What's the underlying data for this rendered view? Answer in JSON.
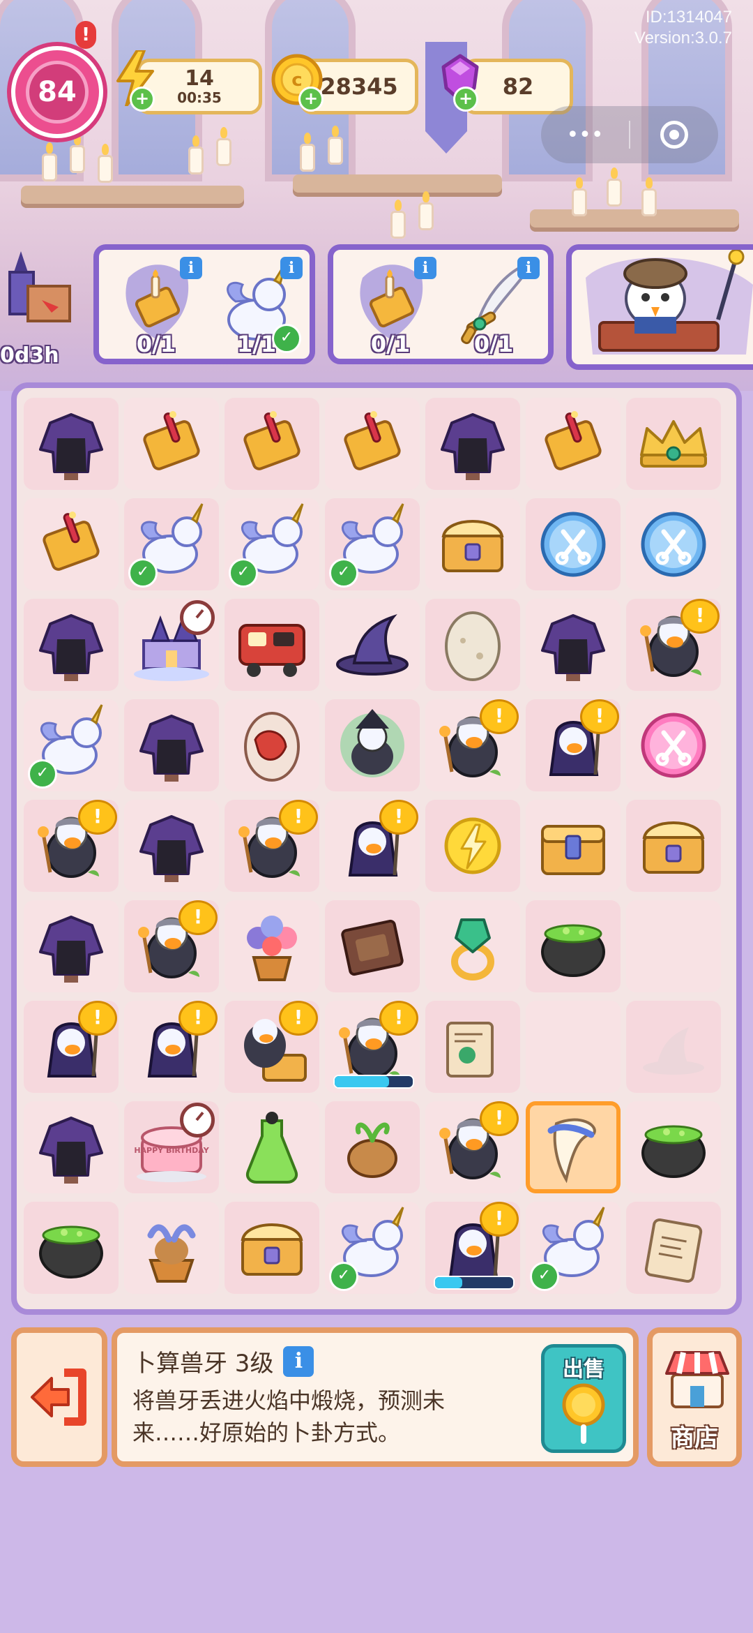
{
  "build": {
    "id": "ID:1314047",
    "version": "Version:3.0.7"
  },
  "player": {
    "level": "84",
    "alert": "!"
  },
  "resources": {
    "energy": {
      "value": "14",
      "timer": "00:35",
      "icon": "lightning-icon"
    },
    "coins": {
      "value": "28345",
      "icon": "coin-icon"
    },
    "gems": {
      "value": "82",
      "icon": "gem-icon"
    }
  },
  "capsule": {
    "more": "•••",
    "close_icon": "target-icon"
  },
  "event": {
    "timer": "0d3h"
  },
  "orders": [
    {
      "items": [
        {
          "icon": "candle-scroll-icon",
          "count": "0/1",
          "done": false
        },
        {
          "icon": "unicorn-icon",
          "count": "1/1",
          "done": true
        }
      ]
    },
    {
      "items": [
        {
          "icon": "candle-scroll-icon",
          "count": "0/1",
          "done": false
        },
        {
          "icon": "feather-dagger-icon",
          "count": "0/1",
          "done": false
        }
      ]
    }
  ],
  "board": {
    "cols": 7,
    "rows": 9,
    "cells": [
      {
        "item": "robe",
        "bubble": false
      },
      {
        "item": "scroll"
      },
      {
        "item": "scroll"
      },
      {
        "item": "scroll"
      },
      {
        "item": "robe"
      },
      {
        "item": "scroll"
      },
      {
        "item": "crown"
      },
      {
        "item": "scroll"
      },
      {
        "item": "unicorn",
        "check": true
      },
      {
        "item": "unicorn",
        "check": true
      },
      {
        "item": "unicorn",
        "check": true
      },
      {
        "item": "chest"
      },
      {
        "item": "scissors-blue"
      },
      {
        "item": "scissors-blue"
      },
      {
        "item": "robe"
      },
      {
        "item": "castle",
        "clock": true
      },
      {
        "item": "train"
      },
      {
        "item": "hat"
      },
      {
        "item": "egg"
      },
      {
        "item": "robe"
      },
      {
        "item": "owl",
        "bubble": true
      },
      {
        "item": "unicorn",
        "check": true
      },
      {
        "item": "robe"
      },
      {
        "item": "dragon-egg"
      },
      {
        "item": "witch-orb"
      },
      {
        "item": "owl",
        "bubble": true
      },
      {
        "item": "wizard",
        "bubble": true
      },
      {
        "item": "scissors-pink"
      },
      {
        "item": "owl",
        "bubble": true
      },
      {
        "item": "robe"
      },
      {
        "item": "owl",
        "bubble": true
      },
      {
        "item": "wizard",
        "bubble": true
      },
      {
        "item": "energy-coin"
      },
      {
        "item": "chest-closed"
      },
      {
        "item": "chest"
      },
      {
        "item": "robe"
      },
      {
        "item": "owl",
        "bubble": true
      },
      {
        "item": "flower-pot"
      },
      {
        "item": "chocolate"
      },
      {
        "item": "ring"
      },
      {
        "item": "cauldron"
      },
      {
        "item": "empty"
      },
      {
        "item": "wizard",
        "bubble": true
      },
      {
        "item": "wizard",
        "bubble": true
      },
      {
        "item": "owl-chest",
        "bubble": true
      },
      {
        "item": "owl",
        "bubble": true,
        "progress": 0.7
      },
      {
        "item": "map"
      },
      {
        "item": "empty"
      },
      {
        "item": "ghost-hat"
      },
      {
        "item": "robe"
      },
      {
        "item": "cake",
        "clock": true
      },
      {
        "item": "potion"
      },
      {
        "item": "mandrake"
      },
      {
        "item": "owl",
        "bubble": true
      },
      {
        "item": "fang",
        "selected": true
      },
      {
        "item": "cauldron"
      },
      {
        "item": "cauldron"
      },
      {
        "item": "mandrake-pot"
      },
      {
        "item": "chest"
      },
      {
        "item": "unicorn",
        "check": true
      },
      {
        "item": "wizard",
        "bubble": true,
        "progress": 0.35
      },
      {
        "item": "unicorn",
        "check": true
      },
      {
        "item": "map-roll"
      }
    ]
  },
  "cake_text": "HAPPY BIRTHDAY",
  "selected_item": {
    "title": "卜算兽牙 3级",
    "info": "i",
    "description_line1": "将兽牙丢进火焰中煅烧，预测未",
    "description_line2": "来……好原始的卜卦方式。"
  },
  "sell": {
    "label": "出售"
  },
  "shop": {
    "label": "商店"
  },
  "colors": {
    "accent": "#8663cc",
    "panel_border": "#e49a64",
    "sell": "#3fc4c4"
  }
}
